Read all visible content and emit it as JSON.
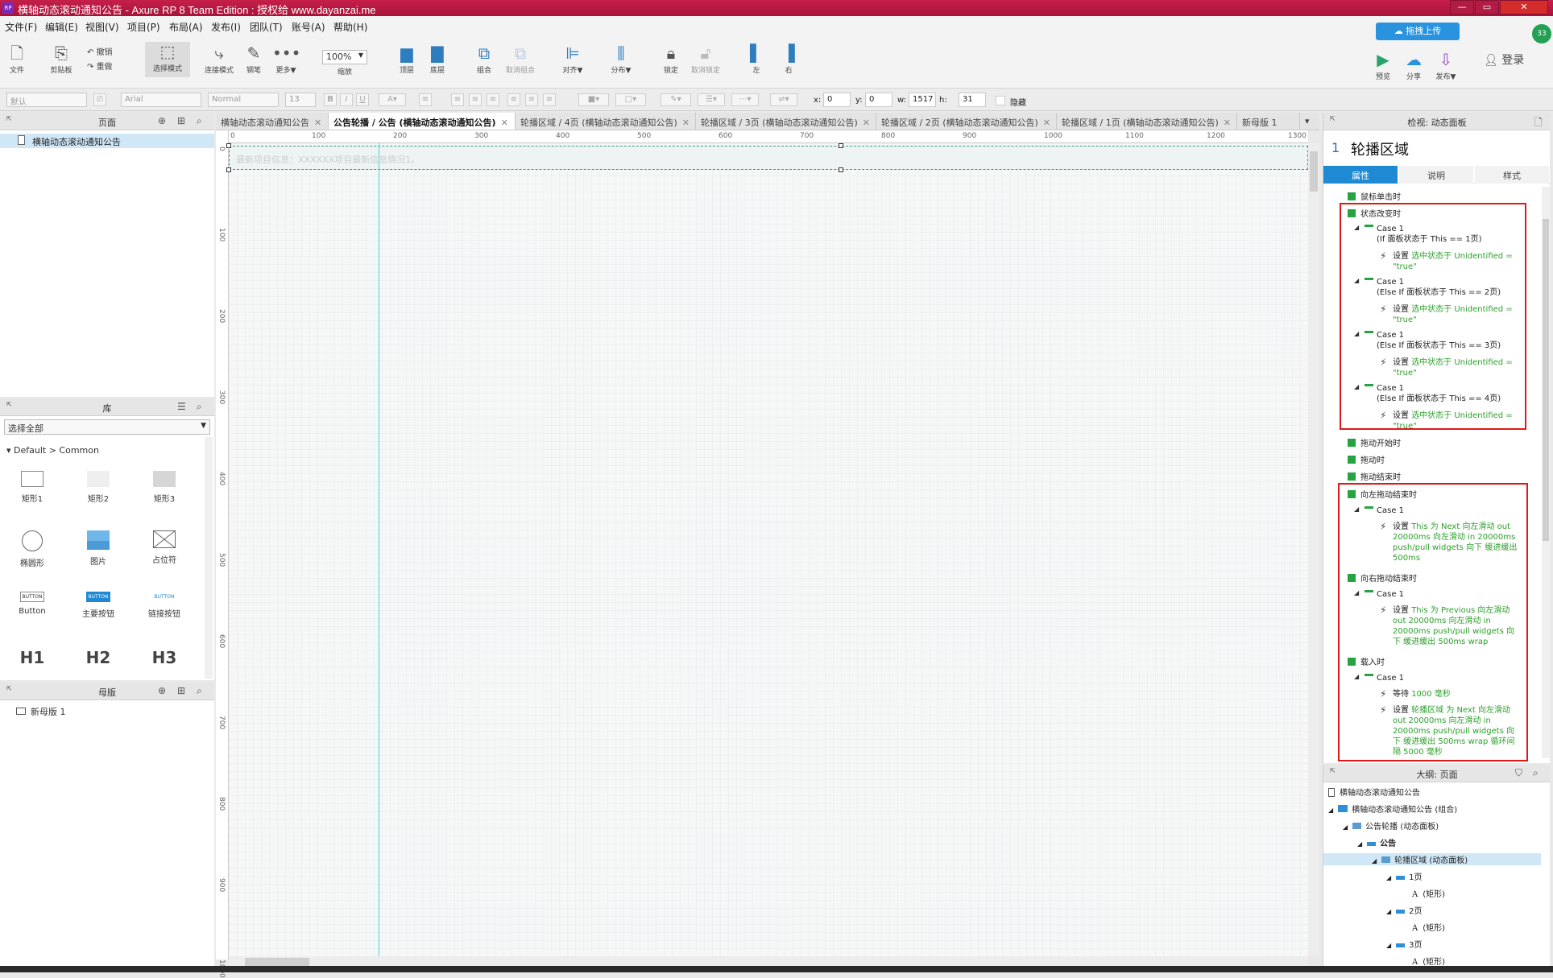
{
  "window": {
    "title": "横轴动态滚动通知公告 - Axure RP 8 Team Edition : 授权给 www.dayanzai.me",
    "app_icon": "RP",
    "controls": [
      "—",
      "▭",
      "✕"
    ]
  },
  "menu": [
    "文件(F)",
    "编辑(E)",
    "视图(V)",
    "项目(P)",
    "布局(A)",
    "发布(I)",
    "团队(T)",
    "账号(A)",
    "帮助(H)"
  ],
  "toolbar": {
    "file": "文件",
    "clipboard": "剪贴板",
    "undo": "撤销",
    "redo": "重做",
    "select_mode": "选择模式",
    "connect_mode": "连接模式",
    "pen": "钢笔",
    "more": "更多▼",
    "zoom_value": "100%",
    "zoom_label": "缩放",
    "top": "顶层",
    "bottom": "底层",
    "group": "组合",
    "ungroup": "取消组合",
    "align": "对齐▼",
    "distribute": "分布▼",
    "lock": "锁定",
    "unlock": "取消锁定",
    "left": "左",
    "right": "右",
    "upload_drag": "拖拽上传",
    "preview": "预览",
    "share": "分享",
    "publish": "发布▼",
    "login": "登录",
    "badge": "33"
  },
  "format_bar": {
    "style": "默认",
    "font": "Arial",
    "weight": "Normal",
    "size": "13",
    "x_label": "x:",
    "x_value": "0",
    "y_label": "y:",
    "y_value": "0",
    "w_label": "w:",
    "w_value": "1517",
    "h_label": "h:",
    "h_value": "31",
    "hidden_label": "隐藏"
  },
  "pages_panel": {
    "title": "页面",
    "items": [
      "横轴动态滚动通知公告"
    ]
  },
  "library_panel": {
    "title": "库",
    "selected": "选择全部",
    "group": "Default > Common",
    "items": [
      {
        "label": "矩形1",
        "icon": "rect-icon"
      },
      {
        "label": "矩形2",
        "icon": "rect-icon"
      },
      {
        "label": "矩形3",
        "icon": "rect-icon"
      },
      {
        "label": "椭圆形",
        "icon": "circle-icon"
      },
      {
        "label": "图片",
        "icon": "image-icon"
      },
      {
        "label": "占位符",
        "icon": "placeholder-icon"
      },
      {
        "label": "Button",
        "icon": "button-icon",
        "sample": "BUTTON"
      },
      {
        "label": "主要按钮",
        "icon": "button-icon",
        "sample": "BUTTON"
      },
      {
        "label": "链接按钮",
        "icon": "button-icon",
        "sample": "BUTTON"
      },
      {
        "label": "H1",
        "icon": "heading-icon"
      },
      {
        "label": "H2",
        "icon": "heading-icon"
      },
      {
        "label": "H3",
        "icon": "heading-icon"
      }
    ]
  },
  "masters_panel": {
    "title": "母版",
    "items": [
      "新母版 1"
    ]
  },
  "tabs": [
    {
      "label": "横轴动态滚动通知公告",
      "active": false
    },
    {
      "label": "公告轮播 / 公告 (横轴动态滚动通知公告)",
      "active": true
    },
    {
      "label": "轮播区域 / 4页 (横轴动态滚动通知公告)",
      "active": false
    },
    {
      "label": "轮播区域 / 3页 (横轴动态滚动通知公告)",
      "active": false
    },
    {
      "label": "轮播区域 / 2页 (横轴动态滚动通知公告)",
      "active": false
    },
    {
      "label": "轮播区域 / 1页 (横轴动态滚动通知公告)",
      "active": false
    },
    {
      "label": "新母版 1",
      "active": false
    }
  ],
  "ruler": {
    "h": [
      "0",
      "100",
      "200",
      "300",
      "400",
      "500",
      "600",
      "700",
      "800",
      "900",
      "1000",
      "1100",
      "1200",
      "1300"
    ],
    "v": [
      "0",
      "100",
      "200",
      "300",
      "400",
      "500",
      "600",
      "700",
      "800",
      "900",
      "1000"
    ]
  },
  "canvas": {
    "notice_text": "最新项目信息：XXXXXX项目最新信息情况1。"
  },
  "inspector": {
    "header": "检视: 动态面板",
    "index": "1",
    "name": "轮播区域",
    "tabs": [
      "属性",
      "说明",
      "样式"
    ],
    "events": {
      "mouse_click": "鼠标单击时",
      "state_change": "状态改变时",
      "cases_state": [
        {
          "case": "Case 1",
          "cond": "(If 面板状态于 This == 1页)",
          "action": "设置",
          "target": "选中状态于 Unidentified = \"true\""
        },
        {
          "case": "Case 1",
          "cond": "(Else If 面板状态于 This == 2页)",
          "action": "设置",
          "target": "选中状态于 Unidentified = \"true\""
        },
        {
          "case": "Case 1",
          "cond": "(Else If 面板状态于 This == 3页)",
          "action": "设置",
          "target": "选中状态于 Unidentified = \"true\""
        },
        {
          "case": "Case 1",
          "cond": "(Else If 面板状态于 This == 4页)",
          "action": "设置",
          "target": "选中状态于 Unidentified = \"true\""
        }
      ],
      "drag_start": "拖动开始时",
      "dragging": "拖动时",
      "drag_end": "拖动结束时",
      "swipe_left": "向左拖动结束时",
      "swipe_left_case": {
        "case": "Case 1",
        "action": "设置",
        "target": "This 为 Next 向左滑动 out 20000ms 向左滑动 in 20000ms push/pull widgets 向下 缓进缓出 500ms"
      },
      "swipe_right": "向右拖动结束时",
      "swipe_right_case": {
        "case": "Case 1",
        "action": "设置",
        "target": "This 为 Previous 向左滑动 out 20000ms 向左滑动 in 20000ms push/pull widgets 向下 缓进缓出 500ms wrap"
      },
      "on_load": "载入时",
      "on_load_case": {
        "case": "Case 1",
        "wait_action": "等待",
        "wait_target": "1000 毫秒",
        "set_action": "设置",
        "set_target": "轮播区域 为 Next 向左滑动 out 20000ms 向左滑动 in 20000ms push/pull widgets 向下 缓进缓出 500ms wrap 循环间隔 5000 毫秒"
      }
    }
  },
  "outline": {
    "title": "大纲: 页面",
    "rows": [
      {
        "label": "横轴动态滚动通知公告",
        "level": 0,
        "kind": "page"
      },
      {
        "label": "横轴动态滚动通知公告 (组合)",
        "level": 1,
        "kind": "folder"
      },
      {
        "label": "公告轮播 (动态面板)",
        "level": 2,
        "kind": "panel"
      },
      {
        "label": "公告",
        "level": 3,
        "kind": "state"
      },
      {
        "label": "轮播区域 (动态面板)",
        "level": 4,
        "kind": "panel",
        "selected": true
      },
      {
        "label": "1页",
        "level": 5,
        "kind": "state"
      },
      {
        "label": "(矩形)",
        "level": 6,
        "kind": "text"
      },
      {
        "label": "2页",
        "level": 5,
        "kind": "state"
      },
      {
        "label": "(矩形)",
        "level": 6,
        "kind": "text"
      },
      {
        "label": "3页",
        "level": 5,
        "kind": "state"
      },
      {
        "label": "(矩形)",
        "level": 6,
        "kind": "text"
      }
    ]
  },
  "colors": {
    "titlebar": "#b81a44",
    "accent": "#1f8ad3",
    "highlight_box": "#e01818",
    "action_green": "#2ca02c"
  }
}
